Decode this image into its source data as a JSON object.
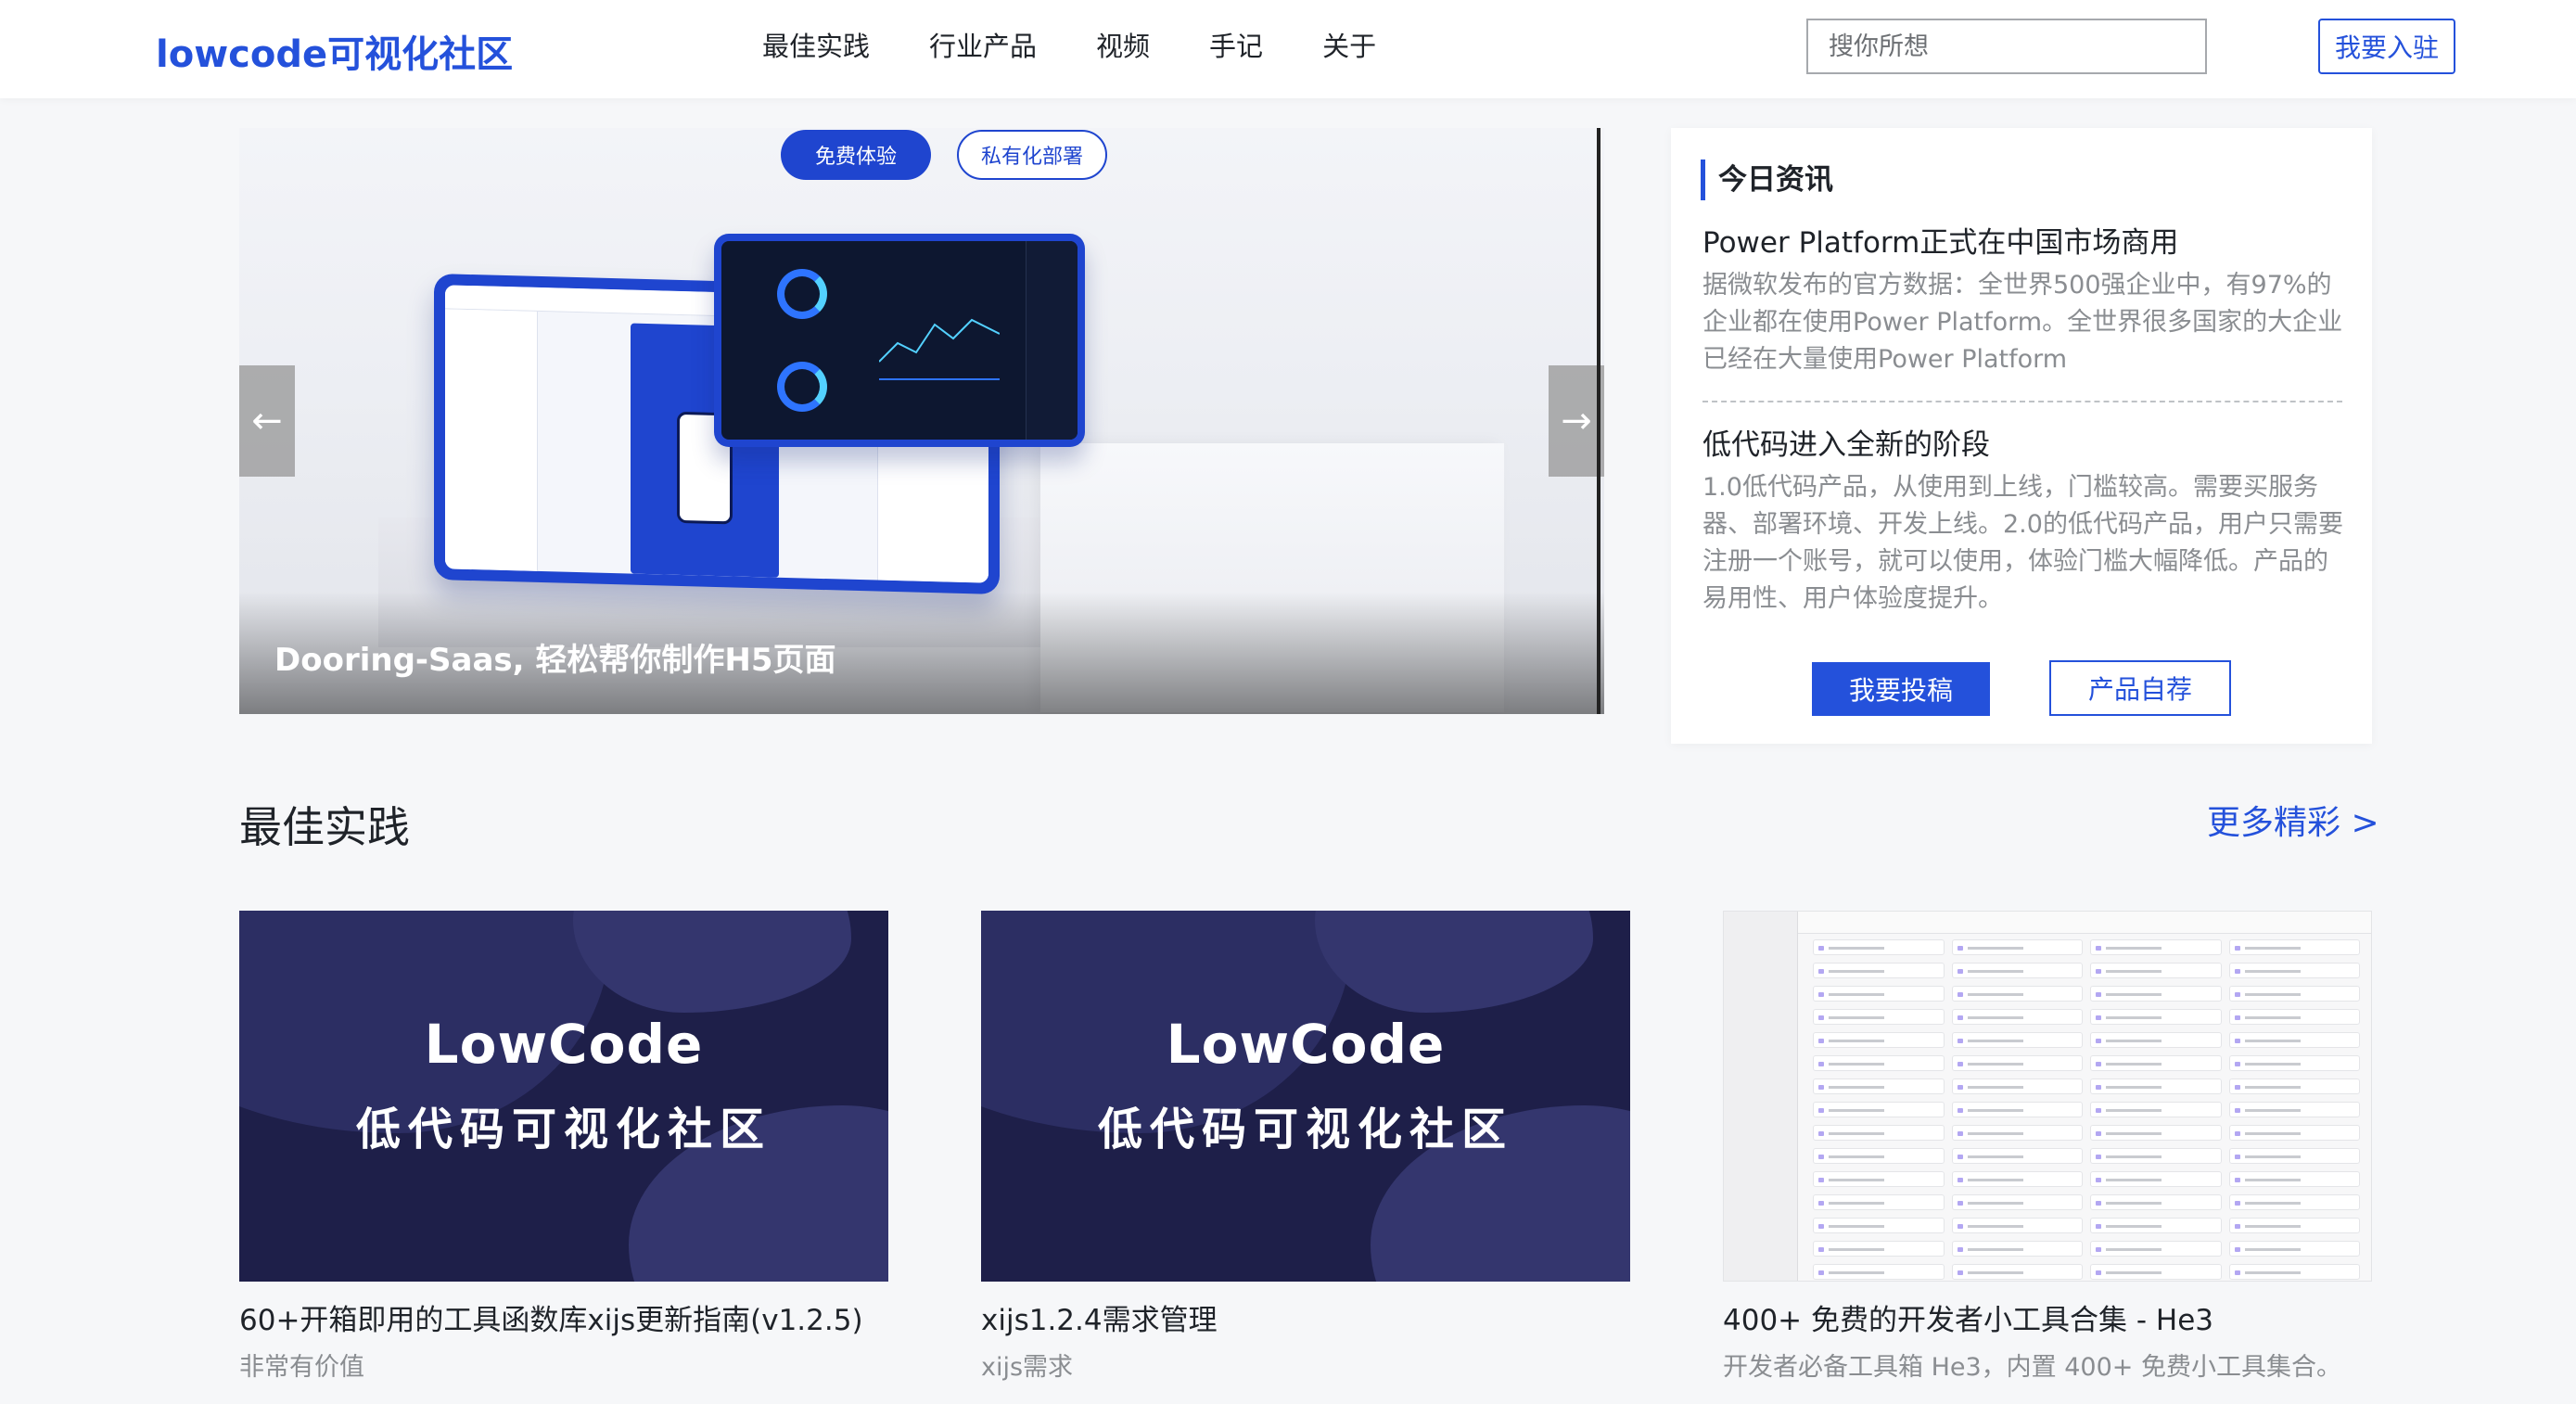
{
  "header": {
    "logo": "lowcode可视化社区",
    "nav": [
      "最佳实践",
      "行业产品",
      "视频",
      "手记",
      "关于"
    ],
    "search_placeholder": "搜你所想",
    "join_label": "我要入驻"
  },
  "carousel": {
    "pill_primary": "免费体验",
    "pill_secondary": "私有化部署",
    "caption": "Dooring-Saas, 轻松帮你制作H5页面",
    "prev_arrow": "←",
    "next_arrow": "→"
  },
  "news": {
    "heading": "今日资讯",
    "items": [
      {
        "title": "Power Platform正式在中国市场商用",
        "body": "据微软发布的官方数据：全世界500强企业中，有97%的企业都在使用Power Platform。全世界很多国家的大企业已经在大量使用Power Platform"
      },
      {
        "title": "低代码进入全新的阶段",
        "body": "1.0低代码产品，从使用到上线，门槛较高。需要买服务器、部署环境、开发上线。2.0的低代码产品，用户只需要注册一个账号，就可以使用，体验门槛大幅降低。产品的易用性、用户体验度提升。"
      }
    ],
    "submit_label": "我要投稿",
    "recommend_label": "产品自荐"
  },
  "best_practice": {
    "title": "最佳实践",
    "more": "更多精彩 >",
    "cards": [
      {
        "image_line1": "LowCode",
        "image_line2": "低代码可视化社区",
        "title": "60+开箱即用的工具函数库xijs更新指南(v1.2.5)",
        "desc": "非常有价值"
      },
      {
        "image_line1": "LowCode",
        "image_line2": "低代码可视化社区",
        "title": "xijs1.2.4需求管理",
        "desc": "xijs需求"
      },
      {
        "title": "400+ 免费的开发者小工具合集 - He3",
        "desc": "开发者必备工具箱 He3，内置 400+ 免费小工具集合。"
      }
    ]
  },
  "colors": {
    "brand": "#2451db",
    "card_bg": "#1e1f49"
  }
}
